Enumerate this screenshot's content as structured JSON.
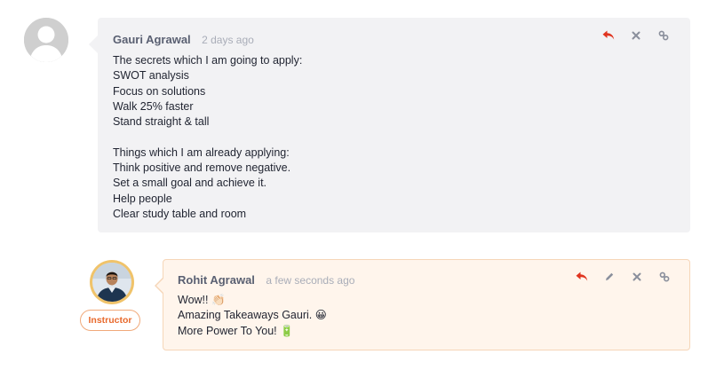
{
  "comments": [
    {
      "author": "Gauri Agrawal",
      "time": "2 days ago",
      "lines": [
        "The secrets which I am going to apply:",
        "SWOT analysis",
        "Focus on solutions",
        "Walk 25% faster",
        "Stand straight & tall",
        "",
        "Things which I am already applying:",
        "Think positive and remove negative.",
        "Set a small goal and achieve it.",
        "Help people",
        "Clear study table and room"
      ],
      "actions": [
        "reply-icon",
        "close-icon",
        "link-icon"
      ]
    },
    {
      "author": "Rohit Agrawal",
      "time": "a few seconds ago",
      "badge": "Instructor",
      "lines": [
        "Wow!! 👏🏻",
        "Amazing Takeaways Gauri. 😀",
        "More Power To You! 🔋"
      ],
      "actions": [
        "reply-icon",
        "edit-icon",
        "close-icon",
        "link-icon"
      ]
    }
  ],
  "colors": {
    "reply": "#e0341f",
    "muted_icon": "#8a8f9c",
    "badge": "#e8692c",
    "comment_bg": "#f2f2f4",
    "instructor_bg": "#fff5ec"
  }
}
